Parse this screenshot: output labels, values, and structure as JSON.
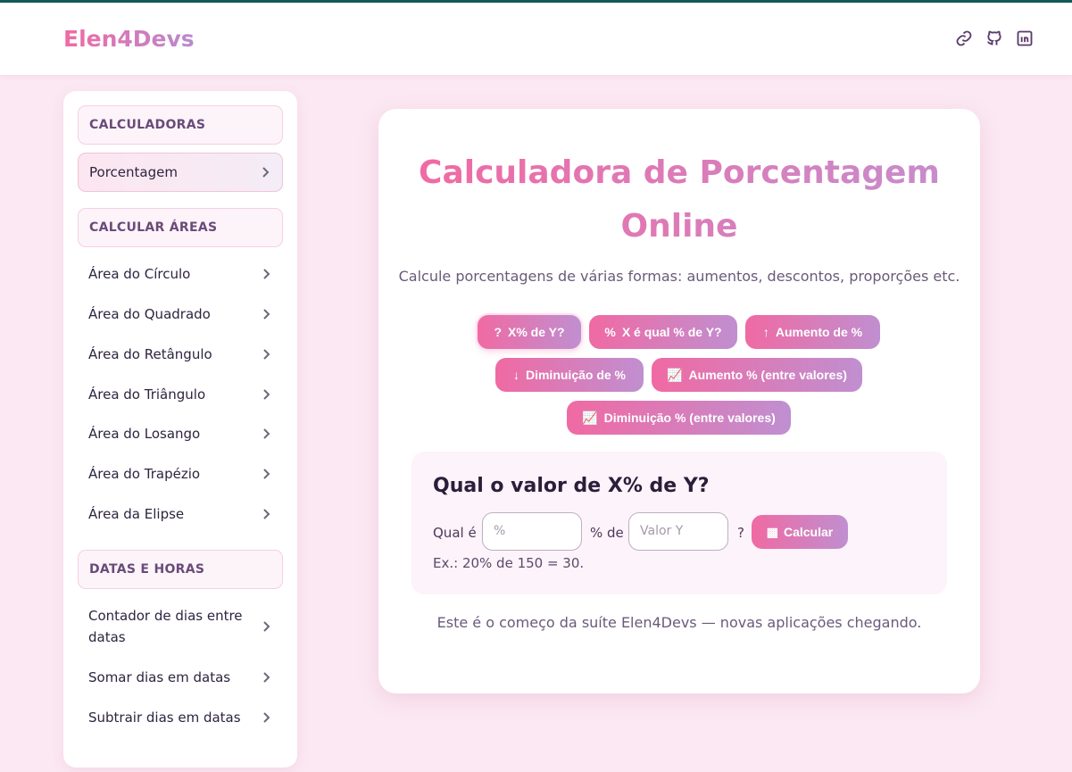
{
  "app": {
    "brand": "Elen4Devs"
  },
  "header_icons": [
    "link-icon",
    "github-icon",
    "linkedin-icon"
  ],
  "sidebar": {
    "sections": [
      {
        "title": "CALCULADORAS",
        "items": [
          {
            "label": "Porcentagem",
            "active": true
          }
        ]
      },
      {
        "title": "CALCULAR ÁREAS",
        "items": [
          {
            "label": "Área do Círculo"
          },
          {
            "label": "Área do Quadrado"
          },
          {
            "label": "Área do Retângulo"
          },
          {
            "label": "Área do Triângulo"
          },
          {
            "label": "Área do Losango"
          },
          {
            "label": "Área do Trapézio"
          },
          {
            "label": "Área da Elipse"
          }
        ]
      },
      {
        "title": "DATAS E HORAS",
        "items": [
          {
            "label": "Contador de dias entre datas"
          },
          {
            "label": "Somar dias em datas"
          },
          {
            "label": "Subtrair dias em datas"
          }
        ]
      }
    ]
  },
  "main": {
    "title": "Calculadora de Porcentagem Online",
    "subtitle": "Calcule porcentagens de várias formas: aumentos, descontos, proporções etc.",
    "modes": [
      {
        "icon": "?",
        "label": "X% de Y?",
        "selected": true
      },
      {
        "icon": "%",
        "label": "X é qual % de Y?"
      },
      {
        "icon": "↑",
        "label": "Aumento de %"
      },
      {
        "icon": "↓",
        "label": "Diminuição de %"
      },
      {
        "icon": "📈",
        "label": "Aumento % (entre valores)"
      },
      {
        "icon": "📈",
        "label": "Diminuição % (entre valores)"
      }
    ],
    "panel": {
      "title": "Qual o valor de X% de Y?",
      "prefix": "Qual é",
      "x_placeholder": "%",
      "middle": "% de",
      "y_placeholder": "Valor Y",
      "suffix": "?",
      "button": "Calcular",
      "example": "Ex.: 20% de 150 = 30."
    },
    "footer_note": "Este é o começo da suíte Elen4Devs — novas aplicações chegando."
  },
  "colors": {
    "accent_start": "#f06aa3",
    "accent_end": "#c08fd0",
    "background": "#fbe8f2",
    "top_border": "#0f5a55"
  }
}
